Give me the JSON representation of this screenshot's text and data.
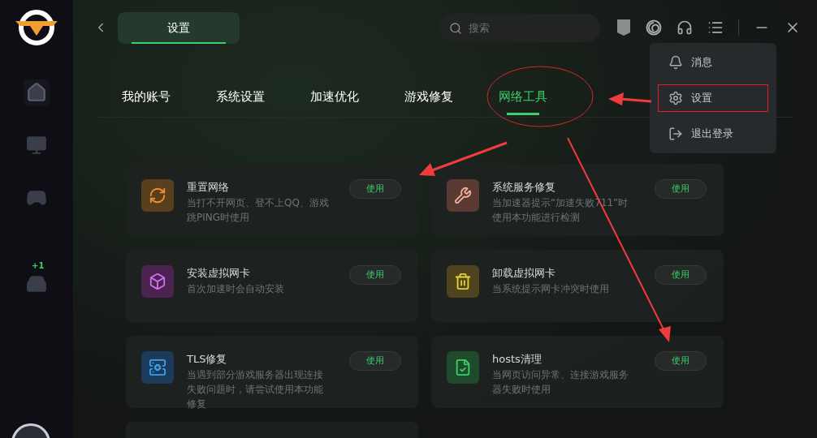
{
  "sidebar": {
    "items": [
      {
        "kind": "home",
        "selected": true
      },
      {
        "kind": "monitor",
        "selected": false
      },
      {
        "kind": "gamepad",
        "selected": false
      },
      {
        "kind": "inbox",
        "badge": "+1",
        "selected": false
      }
    ]
  },
  "header": {
    "tab": {
      "label": "设置",
      "selected": true
    },
    "search": {
      "placeholder": "搜索"
    }
  },
  "tabs": [
    {
      "label": "我的账号",
      "selected": false
    },
    {
      "label": "系统设置",
      "selected": false
    },
    {
      "label": "加速优化",
      "selected": false
    },
    {
      "label": "游戏修复",
      "selected": false
    },
    {
      "label": "网络工具",
      "selected": true
    }
  ],
  "tools": [
    {
      "kind": "reset",
      "title": "重置网络",
      "description": "当打不开网页、登不上QQ、游戏跳PING时使用",
      "button": "使用"
    },
    {
      "kind": "service",
      "title": "系统服务修复",
      "description": "当加速器提示“加速失败711”时使用本功能进行检测",
      "button": "使用"
    },
    {
      "kind": "install",
      "title": "安装虚拟网卡",
      "description": "首次加速时会自动安装",
      "button": "使用"
    },
    {
      "kind": "uninstall",
      "title": "卸载虚拟网卡",
      "description": "当系统提示网卡冲突时使用",
      "button": "使用"
    },
    {
      "kind": "tls",
      "title": "TLS修复",
      "description": "当遇到部分游戏服务器出现连接失败问题时，请尝试使用本功能修复",
      "button": "使用"
    },
    {
      "kind": "hosts",
      "title": "hosts清理",
      "description": "当网页访问异常、连接游戏服务器失败时使用",
      "button": "使用"
    }
  ],
  "menu": {
    "items": [
      {
        "kind": "bell",
        "label": "消息",
        "highlighted": false
      },
      {
        "kind": "gear",
        "label": "设置",
        "highlighted": true
      },
      {
        "kind": "logout",
        "label": "退出登录",
        "highlighted": false
      }
    ]
  }
}
